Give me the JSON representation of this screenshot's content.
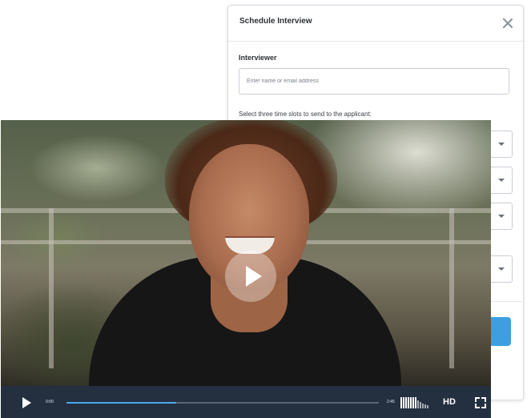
{
  "modal": {
    "title": "Schedule Interview",
    "interviewer_label": "Interviewer",
    "interviewer_placeholder": "Enter name or email address",
    "interviewer_value": "",
    "slots_label": "Select three time slots to send to the applicant:",
    "accent_color": "#3d9fe0"
  },
  "video": {
    "current_time": "0:00",
    "duration": "2:45",
    "progress_fraction": 0.35,
    "quality_label": "HD"
  }
}
